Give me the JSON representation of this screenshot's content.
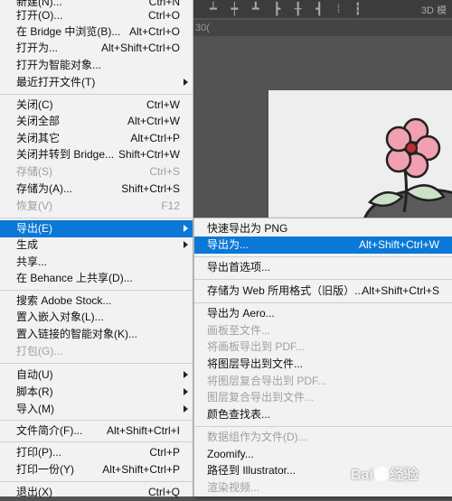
{
  "toolbar": {
    "align_glyphs": "┷ ┿ ┻ ┣ ╂ ┫ ⁞ ┇",
    "view3d": "3D 模"
  },
  "doc_tab": {
    "fragment": "30("
  },
  "file_menu": [
    {
      "label": "新建(N)...",
      "shortcut": "Ctrl+N"
    },
    {
      "label": "打开(O)...",
      "shortcut": "Ctrl+O"
    },
    {
      "label": "在 Bridge 中浏览(B)...",
      "shortcut": "Alt+Ctrl+O"
    },
    {
      "label": "打开为...",
      "shortcut": "Alt+Shift+Ctrl+O"
    },
    {
      "label": "打开为智能对象..."
    },
    {
      "label": "最近打开文件(T)",
      "submenu": true
    },
    {
      "label": "关闭(C)",
      "shortcut": "Ctrl+W"
    },
    {
      "label": "关闭全部",
      "shortcut": "Alt+Ctrl+W"
    },
    {
      "label": "关闭其它",
      "shortcut": "Alt+Ctrl+P"
    },
    {
      "label": "关闭并转到 Bridge...",
      "shortcut": "Shift+Ctrl+W"
    },
    {
      "label": "存储(S)",
      "shortcut": "Ctrl+S",
      "disabled": true
    },
    {
      "label": "存储为(A)...",
      "shortcut": "Shift+Ctrl+S"
    },
    {
      "label": "恢复(V)",
      "shortcut": "F12",
      "disabled": true
    },
    {
      "label": "导出(E)",
      "submenu": true,
      "selected": true
    },
    {
      "label": "生成",
      "submenu": true
    },
    {
      "label": "共享..."
    },
    {
      "label": "在 Behance 上共享(D)..."
    },
    {
      "label": "搜索 Adobe Stock..."
    },
    {
      "label": "置入嵌入对象(L)..."
    },
    {
      "label": "置入链接的智能对象(K)..."
    },
    {
      "label": "打包(G)...",
      "disabled": true
    },
    {
      "label": "自动(U)",
      "submenu": true
    },
    {
      "label": "脚本(R)",
      "submenu": true
    },
    {
      "label": "导入(M)",
      "submenu": true
    },
    {
      "label": "文件简介(F)...",
      "shortcut": "Alt+Shift+Ctrl+I"
    },
    {
      "label": "打印(P)...",
      "shortcut": "Ctrl+P"
    },
    {
      "label": "打印一份(Y)",
      "shortcut": "Alt+Shift+Ctrl+P"
    },
    {
      "label": "退出(X)",
      "shortcut": "Ctrl+Q"
    }
  ],
  "export_submenu": [
    {
      "label": "快速导出为 PNG"
    },
    {
      "label": "导出为...",
      "shortcut": "Alt+Shift+Ctrl+W",
      "selected": true
    },
    {
      "label": "导出首选项..."
    },
    {
      "label": "存储为 Web 所用格式（旧版）...",
      "shortcut": "Alt+Shift+Ctrl+S"
    },
    {
      "label": "导出为 Aero..."
    },
    {
      "label": "画板至文件...",
      "disabled": true
    },
    {
      "label": "将画板导出到 PDF...",
      "disabled": true
    },
    {
      "label": "将图层导出到文件..."
    },
    {
      "label": "将图层复合导出到 PDF...",
      "disabled": true
    },
    {
      "label": "图层复合导出到文件...",
      "disabled": true
    },
    {
      "label": "颜色查找表..."
    },
    {
      "label": "数据组作为文件(D)...",
      "disabled": true
    },
    {
      "label": "Zoomify..."
    },
    {
      "label": "路径到 Illustrator..."
    },
    {
      "label": "渲染视频...",
      "disabled": true
    }
  ],
  "watermark": {
    "text_a": "Bai",
    "text_b": "经验"
  },
  "colors": {
    "selection": "#0a78d7",
    "menu_bg": "#f2f2f2",
    "flower_petal": "#f0a0b0"
  }
}
